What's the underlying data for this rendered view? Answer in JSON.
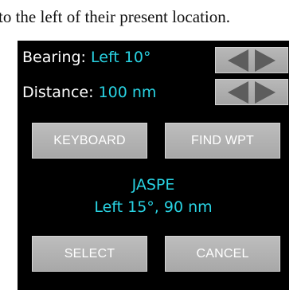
{
  "caption": "to the left of their present location.",
  "bearing": {
    "label": "Bearing:",
    "value": "Left 10°"
  },
  "distance": {
    "label": "Distance:",
    "value": "100 nm"
  },
  "buttons": {
    "keyboard": "KEYBOARD",
    "find_wpt": "FIND WPT",
    "select": "SELECT",
    "cancel": "CANCEL"
  },
  "waypoint": {
    "name": "JASPE",
    "detail": "Left 15°, 90 nm"
  },
  "icons": {
    "arrow_left": "triangle-left",
    "arrow_right": "triangle-right"
  },
  "colors": {
    "accent": "#29d3e3",
    "panel_bg": "#000000",
    "button_bg": "#b0b0b0",
    "arrow": "#5d5d5d"
  }
}
